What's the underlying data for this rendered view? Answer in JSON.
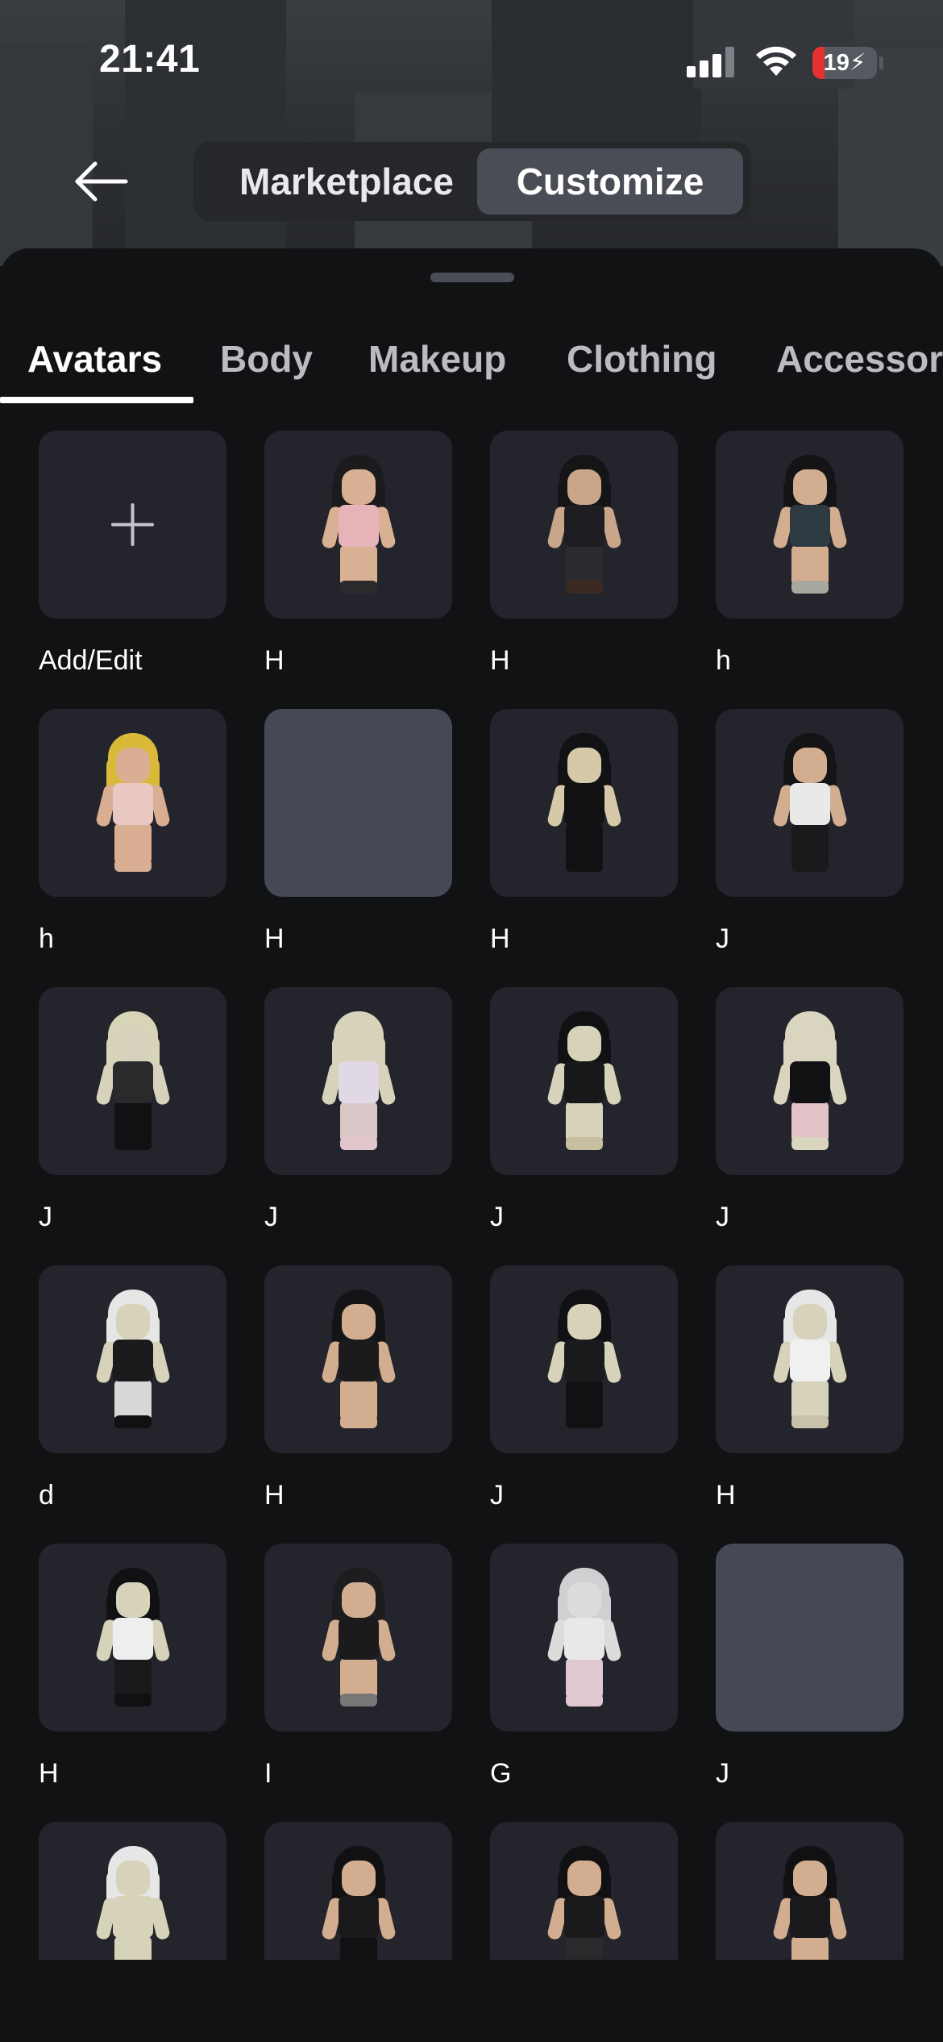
{
  "status_bar": {
    "time": "21:41",
    "battery_level": "19",
    "battery_fraction": 0.19,
    "signal_icon": "cellular-signal-icon",
    "wifi_icon": "wifi-icon",
    "battery_icon": "battery-charging-icon"
  },
  "header": {
    "back_icon": "arrow-left-icon",
    "segments": [
      "Marketplace",
      "Customize"
    ],
    "active_segment": "Customize"
  },
  "tabs": {
    "items": [
      "Avatars",
      "Body",
      "Makeup",
      "Clothing",
      "Accessor"
    ],
    "active": "Avatars"
  },
  "avatars": {
    "add_label": "Add/Edit",
    "add_icon": "plus-icon",
    "items": [
      {
        "label": "H"
      },
      {
        "label": "H"
      },
      {
        "label": "h"
      },
      {
        "label": "h"
      },
      {
        "label": "H"
      },
      {
        "label": "H"
      },
      {
        "label": "J"
      },
      {
        "label": "J"
      },
      {
        "label": "J"
      },
      {
        "label": "J"
      },
      {
        "label": "J"
      },
      {
        "label": "d"
      },
      {
        "label": "H"
      },
      {
        "label": "J"
      },
      {
        "label": "H"
      },
      {
        "label": "H"
      },
      {
        "label": "I"
      },
      {
        "label": "G"
      },
      {
        "label": "J"
      },
      {
        "label": ""
      },
      {
        "label": ""
      },
      {
        "label": ""
      },
      {
        "label": ""
      }
    ]
  },
  "colors": {
    "background": "#111214",
    "card": "#24252c",
    "card_blank": "#464955",
    "active_segment": "#4a4d56",
    "battery_low": "#e5312f"
  }
}
